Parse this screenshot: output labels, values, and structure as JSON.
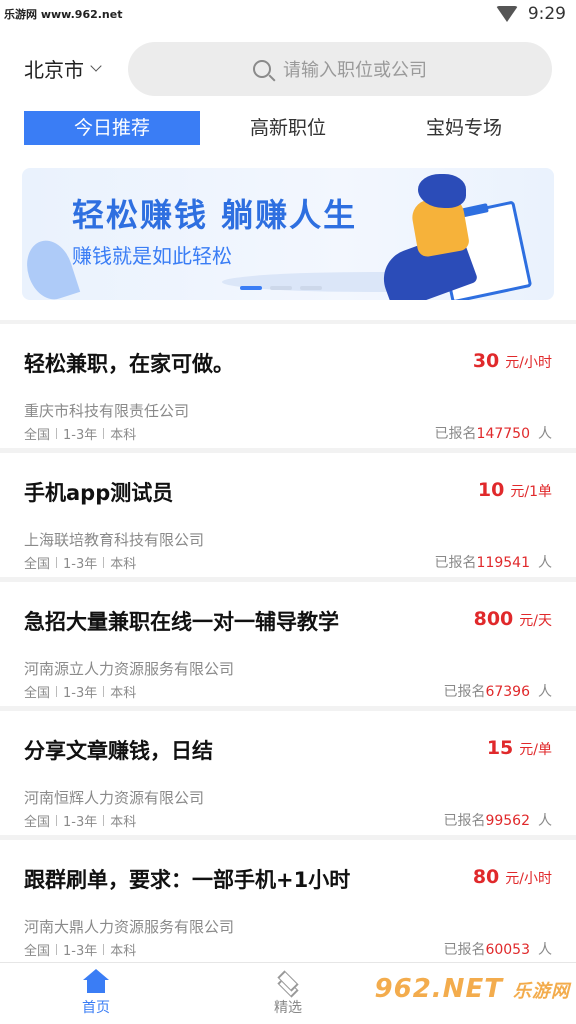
{
  "status_bar": {
    "site": "乐游网 www.962.net",
    "time": "9:29"
  },
  "header": {
    "city": "北京市",
    "search_placeholder": "请输入职位或公司"
  },
  "tabs": [
    {
      "label": "今日推荐",
      "active": true
    },
    {
      "label": "高新职位",
      "active": false
    },
    {
      "label": "宝妈专场",
      "active": false
    }
  ],
  "banner": {
    "title": "轻松赚钱  躺赚人生",
    "subtitle": "赚钱就是如此轻松"
  },
  "jobs": [
    {
      "title": "轻松兼职，在家可做。",
      "salary": "30",
      "unit": "元/小时",
      "company": "重庆市科技有限责任公司",
      "area": "全国",
      "exp": "1-3年",
      "edu": "本科",
      "signup_prefix": "已报名",
      "count": "147750",
      "count_unit": "人"
    },
    {
      "title": "手机app测试员",
      "salary": "10",
      "unit": "元/1单",
      "company": "上海联培教育科技有限公司",
      "area": "全国",
      "exp": "1-3年",
      "edu": "本科",
      "signup_prefix": "已报名",
      "count": "119541",
      "count_unit": "人"
    },
    {
      "title": "急招大量兼职在线一对一辅导教学",
      "salary": "800",
      "unit": "元/天",
      "company": "河南源立人力资源服务有限公司",
      "area": "全国",
      "exp": "1-3年",
      "edu": "本科",
      "signup_prefix": "已报名",
      "count": "67396",
      "count_unit": "人"
    },
    {
      "title": "分享文章赚钱，日结",
      "salary": "15",
      "unit": "元/单",
      "company": "河南恒辉人力资源有限公司",
      "area": "全国",
      "exp": "1-3年",
      "edu": "本科",
      "signup_prefix": "已报名",
      "count": "99562",
      "count_unit": "人"
    },
    {
      "title": "跟群刷单，要求：一部手机+1小时",
      "salary": "80",
      "unit": "元/小时",
      "company": "河南大鼎人力资源服务有限公司",
      "area": "全国",
      "exp": "1-3年",
      "edu": "本科",
      "signup_prefix": "已报名",
      "count": "60053",
      "count_unit": "人"
    }
  ],
  "bottom_nav": [
    {
      "label": "首页",
      "icon": "home-icon",
      "active": true
    },
    {
      "label": "精选",
      "icon": "layers-icon",
      "active": false
    }
  ],
  "watermark": {
    "brand": "962.NET",
    "sub": "乐游网"
  },
  "colors": {
    "accent": "#3a7df5",
    "salary": "#e0292b"
  }
}
